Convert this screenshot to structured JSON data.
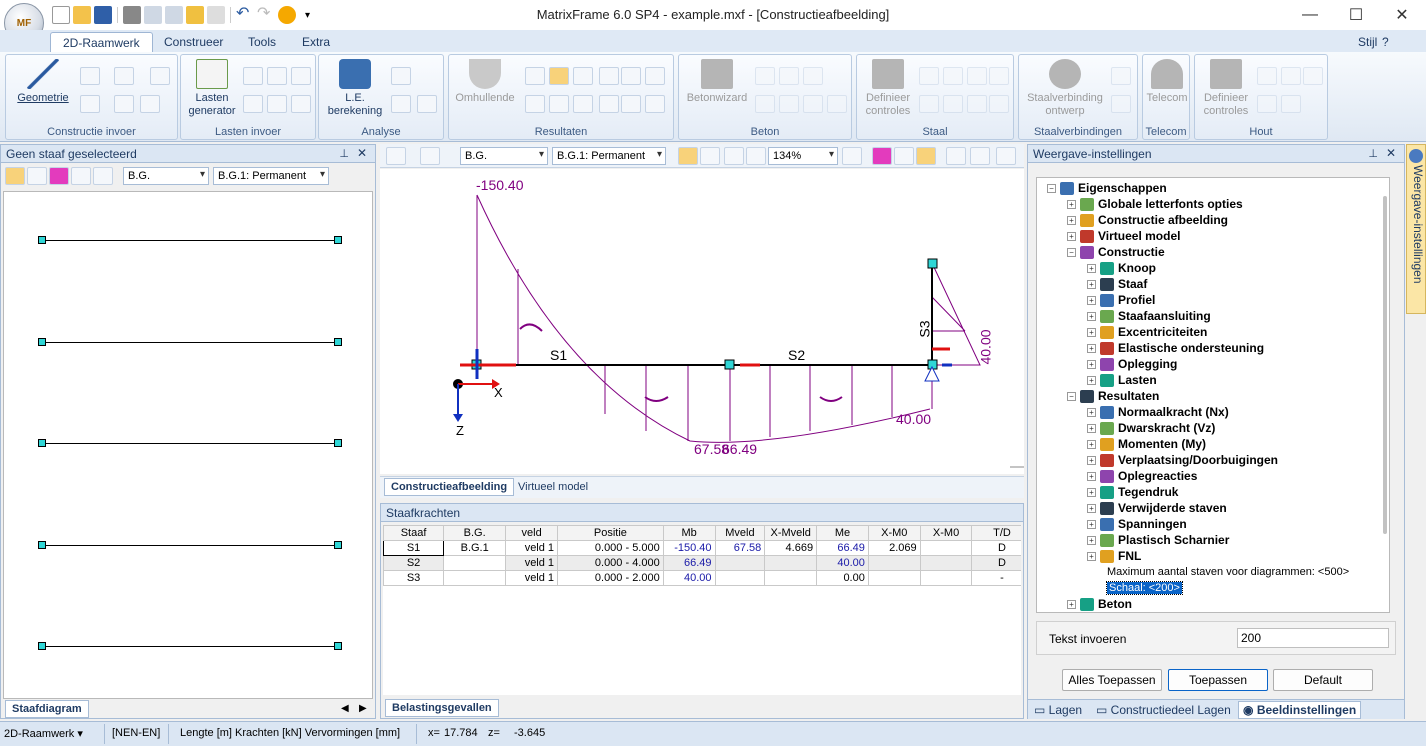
{
  "window": {
    "title": "MatrixFrame 6.0 SP4 - example.mxf - [Constructieafbeelding]",
    "min": "—",
    "max": "☐",
    "close": "✕"
  },
  "app_button": "MF",
  "tabs": [
    "2D-Raamwerk",
    "Construeer",
    "Tools",
    "Extra"
  ],
  "style_menu": "Stijl",
  "ribbon": {
    "groups": [
      "Constructie invoer",
      "Lasten invoer",
      "Analyse",
      "Resultaten",
      "Beton",
      "Staal",
      "Staalverbindingen",
      "Telecom",
      "Hout"
    ],
    "buttons": {
      "geometrie": "Geometrie",
      "lasten_generator": "Lasten generator",
      "le_berekening": "L.E. berekening",
      "omhullende": "Omhullende",
      "betonwizard": "Betonwizard",
      "definieer_staal": "Definieer controles",
      "staalverbinding": "Staalverbinding ontwerp",
      "telecom": "Telecom",
      "definieer_hout": "Definieer controles"
    }
  },
  "left_panel": {
    "title": "Geen staaf geselecteerd",
    "combo1": "B.G.",
    "combo2": "B.G.1: Permanent",
    "bottom_tab": "Staafdiagram"
  },
  "center": {
    "combo1": "B.G.",
    "combo2": "B.G.1: Permanent",
    "zoom": "134%",
    "tabs": [
      "Constructieafbeelding",
      "Virtueel model"
    ],
    "labels": {
      "top": "-150.40",
      "s1": "S1",
      "s2": "S2",
      "s3": "S3",
      "right": "40.00",
      "mid": "67.58",
      "mid2": "66.49",
      "bottom_right": "40.00",
      "x": "X",
      "z": "Z"
    }
  },
  "table": {
    "title": "Staafkrachten",
    "headers": [
      "Staaf",
      "B.G.",
      "veld",
      "Positie",
      "Mb",
      "Mveld",
      "X-Mveld",
      "Me",
      "X-M0",
      "X-M0",
      "T/D"
    ],
    "rows": [
      [
        "S1",
        "B.G.1",
        "veld 1",
        "0.000 - 5.000",
        "-150.40",
        "67.58",
        "4.669",
        "66.49",
        "2.069",
        "",
        "D"
      ],
      [
        "S2",
        "",
        "veld 1",
        "0.000 - 4.000",
        "66.49",
        "",
        "",
        "40.00",
        "",
        "",
        "D"
      ],
      [
        "S3",
        "",
        "veld 1",
        "0.000 - 2.000",
        "40.00",
        "",
        "",
        "0.00",
        "",
        "",
        "-"
      ]
    ],
    "bottom_tab": "Belastingsgevallen"
  },
  "right_panel": {
    "title": "Weergave-instellingen",
    "vertical_tab": "Weergave-instellingen",
    "tree": [
      {
        "label": "Eigenschappen",
        "level": 0,
        "exp": "−",
        "bold": true
      },
      {
        "label": "Globale letterfonts opties",
        "level": 1,
        "exp": "+",
        "bold": true
      },
      {
        "label": "Constructie afbeelding",
        "level": 1,
        "exp": "+",
        "bold": true
      },
      {
        "label": "Virtueel model",
        "level": 1,
        "exp": "+",
        "bold": true
      },
      {
        "label": "Constructie",
        "level": 1,
        "exp": "−",
        "bold": true
      },
      {
        "label": "Knoop",
        "level": 2,
        "exp": "+",
        "bold": true
      },
      {
        "label": "Staaf",
        "level": 2,
        "exp": "+",
        "bold": true
      },
      {
        "label": "Profiel",
        "level": 2,
        "exp": "+",
        "bold": true
      },
      {
        "label": "Staafaansluiting",
        "level": 2,
        "exp": "+",
        "bold": true
      },
      {
        "label": "Excentriciteiten",
        "level": 2,
        "exp": "+",
        "bold": true
      },
      {
        "label": "Elastische ondersteuning",
        "level": 2,
        "exp": "+",
        "bold": true
      },
      {
        "label": "Oplegging",
        "level": 2,
        "exp": "+",
        "bold": true
      },
      {
        "label": "Lasten",
        "level": 2,
        "exp": "+",
        "bold": true
      },
      {
        "label": "Resultaten",
        "level": 1,
        "exp": "−",
        "bold": true
      },
      {
        "label": "Normaalkracht (Nx)",
        "level": 2,
        "exp": "+",
        "bold": true
      },
      {
        "label": "Dwarskracht (Vz)",
        "level": 2,
        "exp": "+",
        "bold": true
      },
      {
        "label": "Momenten (My)",
        "level": 2,
        "exp": "+",
        "bold": true
      },
      {
        "label": "Verplaatsing/Doorbuigingen",
        "level": 2,
        "exp": "+",
        "bold": true
      },
      {
        "label": "Oplegreacties",
        "level": 2,
        "exp": "+",
        "bold": true
      },
      {
        "label": "Tegendruk",
        "level": 2,
        "exp": "+",
        "bold": true
      },
      {
        "label": "Verwijderde staven",
        "level": 2,
        "exp": "+",
        "bold": true
      },
      {
        "label": "Spanningen",
        "level": 2,
        "exp": "+",
        "bold": true
      },
      {
        "label": "Plastisch Scharnier",
        "level": 2,
        "exp": "+",
        "bold": true
      },
      {
        "label": "FNL",
        "level": 2,
        "exp": "+",
        "bold": true
      },
      {
        "label": "Maximum aantal staven voor diagrammen: <500>",
        "level": 3,
        "exp": "",
        "bold": false
      },
      {
        "label": "Schaal: <200>",
        "level": 3,
        "exp": "",
        "bold": false,
        "selected": true
      },
      {
        "label": "Beton",
        "level": 1,
        "exp": "+",
        "bold": true
      }
    ],
    "input_label": "Tekst invoeren",
    "input_value": "200",
    "buttons": [
      "Alles Toepassen",
      "Toepassen",
      "Default"
    ],
    "bottom_tabs": [
      "Lagen",
      "Constructiedeel Lagen",
      "Beeldinstellingen"
    ]
  },
  "status": {
    "mode": "2D-Raamwerk",
    "norm": "[NEN-EN]",
    "units": "Lengte [m] Krachten [kN] Vervormingen [mm]",
    "x_label": "x=",
    "x": "17.784",
    "z_label": "z=",
    "z": "-3.645"
  },
  "colors": {
    "accent": "#1f3b63",
    "diagram": "#800080",
    "node": "#2fd6d6",
    "selected": "#0a64c8"
  }
}
